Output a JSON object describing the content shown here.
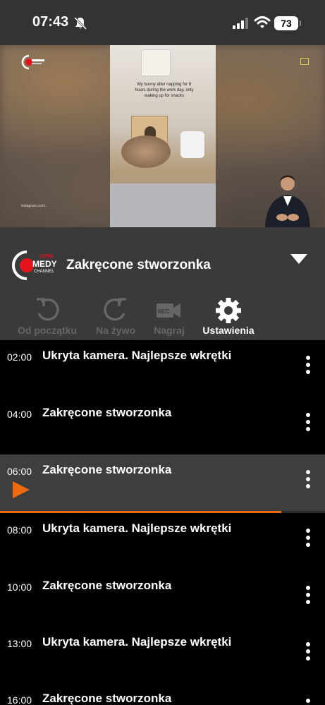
{
  "status_bar": {
    "time": "07:43",
    "battery": "73",
    "icons": [
      "bell-slash-icon",
      "signal-icon",
      "wifi-icon",
      "battery-icon"
    ]
  },
  "player": {
    "overlay_text": "My bunny after napping for 8 hours during the work day, only waking up for snacks",
    "caption": "instagram.com/..."
  },
  "channel": {
    "logo_text": "MEDY",
    "logo_sub": "CHANNEL",
    "logo_badge": "EXTRA",
    "program_title": "Zakręcone stworzonka",
    "dropdown_icon": "triangle-down-icon"
  },
  "actions": [
    {
      "label": "Od początku",
      "icon": "restart-icon",
      "enabled": false
    },
    {
      "label": "Na żywo",
      "icon": "live-icon",
      "enabled": false
    },
    {
      "label": "Nagraj",
      "icon": "rec-camera-icon",
      "enabled": false
    },
    {
      "label": "Ustawienia",
      "icon": "gear-icon",
      "enabled": true
    }
  ],
  "schedule": [
    {
      "time": "02:00",
      "title": "Ukryta kamera. Najlepsze wkrętki"
    },
    {
      "time": "04:00",
      "title": "Zakręcone stworzonka"
    },
    {
      "time": "06:00",
      "title": "Zakręcone stworzonka",
      "current": true
    },
    {
      "time": "08:00",
      "title": "Ukryta kamera. Najlepsze wkrętki"
    },
    {
      "time": "10:00",
      "title": "Zakręcone stworzonka"
    },
    {
      "time": "13:00",
      "title": "Ukryta kamera. Najlepsze wkrętki"
    },
    {
      "time": "16:00",
      "title": "Zakręcone stworzonka"
    }
  ],
  "current_progress": 0.865,
  "colors": {
    "accent": "#ee6a10",
    "header_bg": "#3a3a3a",
    "status_bg": "#333333",
    "logo_red": "#e3141b"
  }
}
